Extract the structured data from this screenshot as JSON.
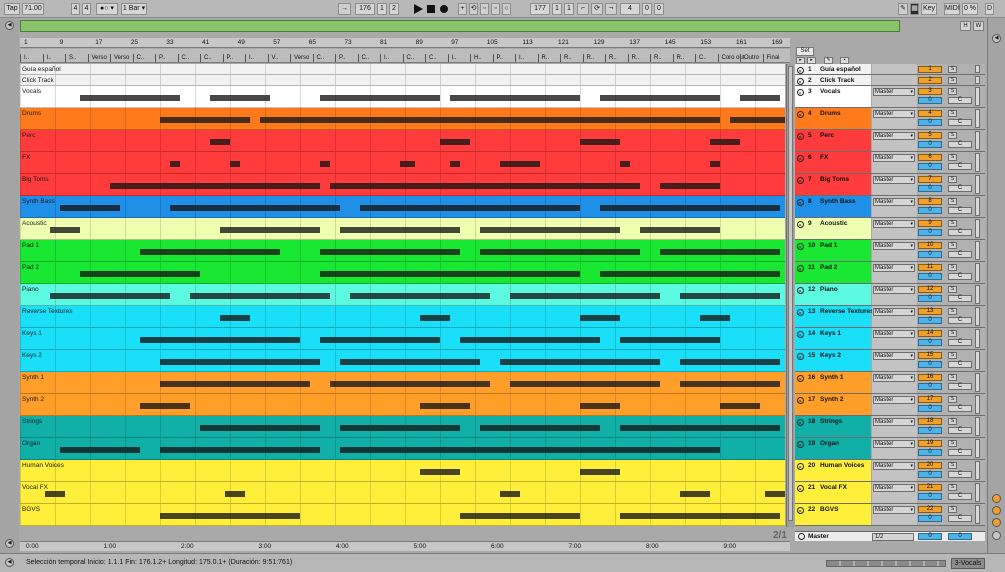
{
  "transport": {
    "tap_label": "Tap",
    "tempo": "71.00",
    "sig_num": "4",
    "sig_den": "4",
    "metro_label": "●○ ▾",
    "quantize": "1 Bar ▾",
    "follow_icon": "follow-icon",
    "position_bar": "176",
    "position_beat": "1",
    "position_sixteenth": "2",
    "loop_start_bar": "177",
    "loop_start_beat": "1",
    "loop_start_sixteenth": "1",
    "loop_len_bar": "4",
    "loop_len_beat": "0",
    "loop_len_sixteenth": "0",
    "key_label": "Key",
    "midi_label": "MIDI",
    "cpu_label": "0 %",
    "disk_label": "D"
  },
  "overview": {
    "h_label": "H",
    "w_label": "W",
    "color": "#87c46a"
  },
  "ruler": {
    "bars": [
      "1",
      "9",
      "17",
      "25",
      "33",
      "41",
      "49",
      "57",
      "65",
      "73",
      "81",
      "89",
      "97",
      "105",
      "113",
      "121",
      "129",
      "137",
      "145",
      "153",
      "161",
      "169"
    ]
  },
  "locators": [
    "I..",
    "I..",
    "S..",
    "Verso",
    "Verso",
    "C..",
    "P..",
    "C..",
    "C..",
    "P..",
    "I..",
    "V..",
    "Verso",
    "C..",
    "P..",
    "C..",
    "I..",
    "C..",
    "C..",
    "I..",
    "H..",
    "P..",
    "I..",
    "R..",
    "R..",
    "R..",
    "R..",
    "R..",
    "R..",
    "R..",
    "C..",
    "Coro out",
    "Outro",
    "Final"
  ],
  "tracks": [
    {
      "num": "1",
      "name": "Guía español",
      "color": "#f2f2f2",
      "height": 11,
      "route": "",
      "clips": []
    },
    {
      "num": "2",
      "name": "Click Track",
      "color": "#f2f2f2",
      "height": 11,
      "route": "",
      "clips": []
    },
    {
      "num": "3",
      "name": "Vocals",
      "color": "#ffffff",
      "height": 22,
      "route": "Master",
      "clips": [
        [
          60,
          160
        ],
        [
          190,
          250
        ],
        [
          300,
          420
        ],
        [
          430,
          560
        ],
        [
          580,
          700
        ],
        [
          720,
          760
        ]
      ]
    },
    {
      "num": "4",
      "name": "Drums",
      "color": "#ff7a1a",
      "height": 22,
      "route": "Master",
      "clips": [
        [
          140,
          230
        ],
        [
          240,
          700
        ],
        [
          710,
          765
        ]
      ]
    },
    {
      "num": "5",
      "name": "Perc",
      "color": "#ff3b3b",
      "height": 22,
      "route": "Master",
      "clips": [
        [
          190,
          210
        ],
        [
          420,
          450
        ],
        [
          560,
          600
        ],
        [
          690,
          720
        ]
      ]
    },
    {
      "num": "6",
      "name": "FX",
      "color": "#ff3b3b",
      "height": 22,
      "route": "Master",
      "clips": [
        [
          150,
          160
        ],
        [
          210,
          220
        ],
        [
          300,
          310
        ],
        [
          380,
          395
        ],
        [
          430,
          440
        ],
        [
          480,
          520
        ],
        [
          600,
          610
        ],
        [
          690,
          700
        ]
      ]
    },
    {
      "num": "7",
      "name": "Big Toms",
      "color": "#ff3b3b",
      "height": 22,
      "route": "Master",
      "clips": [
        [
          90,
          300
        ],
        [
          310,
          620
        ],
        [
          640,
          700
        ]
      ]
    },
    {
      "num": "8",
      "name": "Synth Bass",
      "color": "#1f8fe8",
      "height": 22,
      "route": "Master",
      "clips": [
        [
          40,
          100
        ],
        [
          150,
          320
        ],
        [
          340,
          560
        ],
        [
          580,
          760
        ]
      ]
    },
    {
      "num": "9",
      "name": "Acoustic",
      "color": "#efffb0",
      "height": 22,
      "route": "Master",
      "clips": [
        [
          30,
          60
        ],
        [
          200,
          300
        ],
        [
          320,
          440
        ],
        [
          460,
          600
        ],
        [
          620,
          700
        ]
      ]
    },
    {
      "num": "10",
      "name": "Pad 1",
      "color": "#18e832",
      "height": 22,
      "route": "Master",
      "clips": [
        [
          120,
          260
        ],
        [
          300,
          440
        ],
        [
          460,
          620
        ],
        [
          640,
          760
        ]
      ]
    },
    {
      "num": "11",
      "name": "Pad 2",
      "color": "#18e832",
      "height": 22,
      "route": "Master",
      "clips": [
        [
          60,
          180
        ],
        [
          300,
          560
        ],
        [
          580,
          760
        ]
      ]
    },
    {
      "num": "12",
      "name": "Piano",
      "color": "#5cfae0",
      "height": 22,
      "route": "Master",
      "clips": [
        [
          30,
          150
        ],
        [
          170,
          310
        ],
        [
          330,
          470
        ],
        [
          490,
          640
        ],
        [
          660,
          760
        ]
      ]
    },
    {
      "num": "13",
      "name": "Reverse Textures",
      "color": "#19e0f8",
      "height": 22,
      "route": "Master",
      "clips": [
        [
          200,
          230
        ],
        [
          400,
          430
        ],
        [
          560,
          600
        ],
        [
          680,
          710
        ]
      ]
    },
    {
      "num": "14",
      "name": "Keys 1",
      "color": "#19e0f8",
      "height": 22,
      "route": "Master",
      "clips": [
        [
          120,
          280
        ],
        [
          300,
          420
        ],
        [
          440,
          580
        ],
        [
          600,
          700
        ]
      ]
    },
    {
      "num": "15",
      "name": "Keys 2",
      "color": "#19e0f8",
      "height": 22,
      "route": "Master",
      "clips": [
        [
          140,
          300
        ],
        [
          320,
          460
        ],
        [
          480,
          640
        ],
        [
          660,
          760
        ]
      ]
    },
    {
      "num": "16",
      "name": "Synth 1",
      "color": "#ff9f2a",
      "height": 22,
      "route": "Master",
      "clips": [
        [
          140,
          290
        ],
        [
          310,
          470
        ],
        [
          490,
          640
        ],
        [
          660,
          760
        ]
      ]
    },
    {
      "num": "17",
      "name": "Synth 2",
      "color": "#ff9f2a",
      "height": 22,
      "route": "Master",
      "clips": [
        [
          120,
          170
        ],
        [
          400,
          450
        ],
        [
          560,
          600
        ],
        [
          700,
          740
        ]
      ]
    },
    {
      "num": "18",
      "name": "Strings",
      "color": "#10b0a8",
      "height": 22,
      "route": "Master",
      "clips": [
        [
          180,
          300
        ],
        [
          320,
          440
        ],
        [
          460,
          580
        ],
        [
          600,
          760
        ]
      ]
    },
    {
      "num": "19",
      "name": "Organ",
      "color": "#10b0a8",
      "height": 22,
      "route": "Master",
      "clips": [
        [
          40,
          120
        ],
        [
          140,
          300
        ],
        [
          320,
          700
        ]
      ]
    },
    {
      "num": "20",
      "name": "Human Voices",
      "color": "#ffee3a",
      "height": 22,
      "route": "Master",
      "clips": [
        [
          400,
          440
        ],
        [
          560,
          600
        ]
      ]
    },
    {
      "num": "21",
      "name": "Vocal FX",
      "color": "#ffee3a",
      "height": 22,
      "route": "Master",
      "clips": [
        [
          25,
          45
        ],
        [
          205,
          225
        ],
        [
          480,
          500
        ],
        [
          660,
          690
        ],
        [
          745,
          765
        ]
      ]
    },
    {
      "num": "22",
      "name": "BGVS",
      "color": "#ffee3a",
      "height": 22,
      "route": "Master",
      "clips": [
        [
          140,
          280
        ],
        [
          440,
          560
        ],
        [
          600,
          760
        ]
      ]
    }
  ],
  "header": {
    "set_label": "Set",
    "solo_label": "S",
    "vol_value": "0",
    "pan_value": "C"
  },
  "master": {
    "name": "Master",
    "route": "1/2",
    "vol": "0",
    "pan": "0"
  },
  "counter": "2/1",
  "timeline": {
    "labels": [
      "0:00",
      "1:00",
      "2:00",
      "3:00",
      "4:00",
      "5:00",
      "6:00",
      "7:00",
      "8:00",
      "9:00"
    ]
  },
  "status": {
    "text": "Selección temporal   Inicio: 1.1.1   Fin: 176.1.2+   Longitud: 175.0.1+  (Duración: 9:51:761)",
    "selected_track": "3-Vocals"
  },
  "colors": {
    "accent": "#f0a12b",
    "volume": "#4fb3e8"
  }
}
